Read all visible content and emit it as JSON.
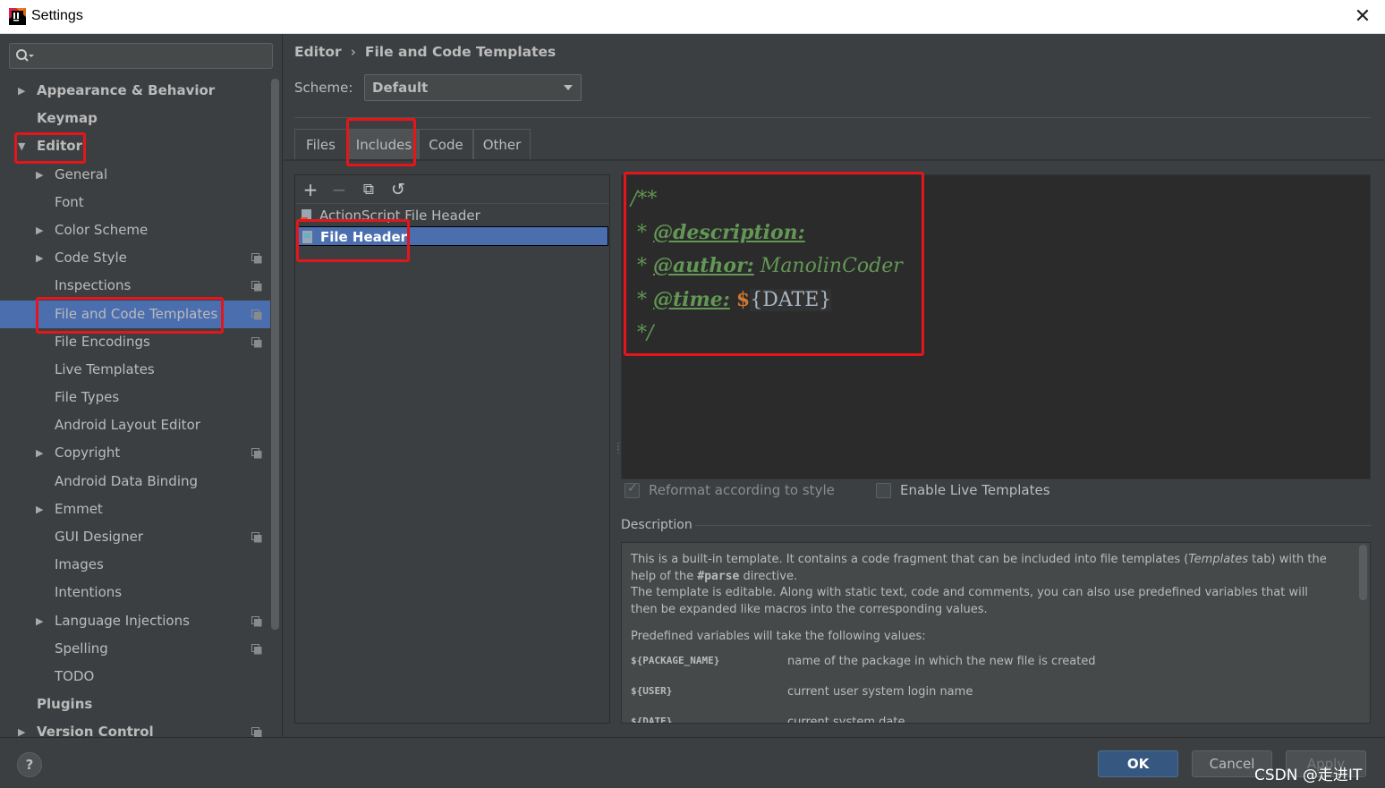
{
  "window": {
    "title": "Settings",
    "close_glyph": "✕"
  },
  "sidebar": {
    "search": {
      "value": "",
      "placeholder": ""
    },
    "items": [
      {
        "label": "Appearance & Behavior",
        "level": 0,
        "arrow": "▶",
        "copy": false
      },
      {
        "label": "Keymap",
        "level": 0,
        "arrow": "",
        "copy": false
      },
      {
        "label": "Editor",
        "level": 0,
        "arrow": "▼",
        "copy": false
      },
      {
        "label": "General",
        "level": 1,
        "arrow": "▶",
        "copy": false
      },
      {
        "label": "Font",
        "level": 1,
        "arrow": "",
        "copy": false
      },
      {
        "label": "Color Scheme",
        "level": 1,
        "arrow": "▶",
        "copy": false
      },
      {
        "label": "Code Style",
        "level": 1,
        "arrow": "▶",
        "copy": true
      },
      {
        "label": "Inspections",
        "level": 1,
        "arrow": "",
        "copy": true
      },
      {
        "label": "File and Code Templates",
        "level": 1,
        "arrow": "",
        "copy": true,
        "selected": true
      },
      {
        "label": "File Encodings",
        "level": 1,
        "arrow": "",
        "copy": true
      },
      {
        "label": "Live Templates",
        "level": 1,
        "arrow": "",
        "copy": false
      },
      {
        "label": "File Types",
        "level": 1,
        "arrow": "",
        "copy": false
      },
      {
        "label": "Android Layout Editor",
        "level": 1,
        "arrow": "",
        "copy": false
      },
      {
        "label": "Copyright",
        "level": 1,
        "arrow": "▶",
        "copy": true
      },
      {
        "label": "Android Data Binding",
        "level": 1,
        "arrow": "",
        "copy": false
      },
      {
        "label": "Emmet",
        "level": 1,
        "arrow": "▶",
        "copy": false
      },
      {
        "label": "GUI Designer",
        "level": 1,
        "arrow": "",
        "copy": true
      },
      {
        "label": "Images",
        "level": 1,
        "arrow": "",
        "copy": false
      },
      {
        "label": "Intentions",
        "level": 1,
        "arrow": "",
        "copy": false
      },
      {
        "label": "Language Injections",
        "level": 1,
        "arrow": "▶",
        "copy": true
      },
      {
        "label": "Spelling",
        "level": 1,
        "arrow": "",
        "copy": true
      },
      {
        "label": "TODO",
        "level": 1,
        "arrow": "",
        "copy": false
      },
      {
        "label": "Plugins",
        "level": 0,
        "arrow": "",
        "copy": false
      },
      {
        "label": "Version Control",
        "level": 0,
        "arrow": "▶",
        "copy": true
      }
    ]
  },
  "breadcrumb": {
    "parent": "Editor",
    "separator": "›",
    "current": "File and Code Templates"
  },
  "scheme": {
    "label": "Scheme:",
    "value": "Default"
  },
  "tabs": [
    {
      "label": "Files"
    },
    {
      "label": "Includes",
      "active": true
    },
    {
      "label": "Code"
    },
    {
      "label": "Other"
    }
  ],
  "toolbar": {
    "add": "+",
    "remove": "−",
    "copy": "⧉",
    "reset": "↺"
  },
  "templates": [
    {
      "label": "ActionScript File Header"
    },
    {
      "label": "File Header",
      "selected": true
    }
  ],
  "editor": {
    "line1": "/**",
    "line2_prefix": " * ",
    "line2_tag": "@description:",
    "line3_prefix": " * ",
    "line3_tag": "@author:",
    "line3_value": " ManolinCoder",
    "line4_prefix": " * ",
    "line4_tag": "@time:",
    "line4_dollar": "$",
    "line4_var": "{DATE}",
    "line5": " */"
  },
  "options": {
    "reformat": {
      "label": "Reformat according to style",
      "checked": true,
      "enabled": false
    },
    "live_templates": {
      "label": "Enable Live Templates",
      "checked": false,
      "enabled": true
    }
  },
  "description": {
    "title": "Description",
    "para1_a": "This is a built-in template. It contains a code fragment that can be included into file templates (",
    "para1_italic": "Templates",
    "para1_b": " tab) with the help of the ",
    "para1_code": "#parse",
    "para1_c": " directive.",
    "para2": "The template is editable. Along with static text, code and comments, you can also use predefined variables that will then be expanded like macros into the corresponding values.",
    "para3": "Predefined variables will take the following values:",
    "variables": [
      {
        "name": "${PACKAGE_NAME}",
        "desc": "name of the package in which the new file is created"
      },
      {
        "name": "${USER}",
        "desc": "current user system login name"
      },
      {
        "name": "${DATE}",
        "desc": "current system date"
      }
    ]
  },
  "buttons": {
    "help": "?",
    "ok": "OK",
    "cancel": "Cancel",
    "apply": "Apply"
  },
  "watermark": "CSDN @走进IT",
  "colors": {
    "accent": "#4b6eaf",
    "highlight": "#e4161b",
    "comment": "#629755",
    "ok": "#365880"
  }
}
